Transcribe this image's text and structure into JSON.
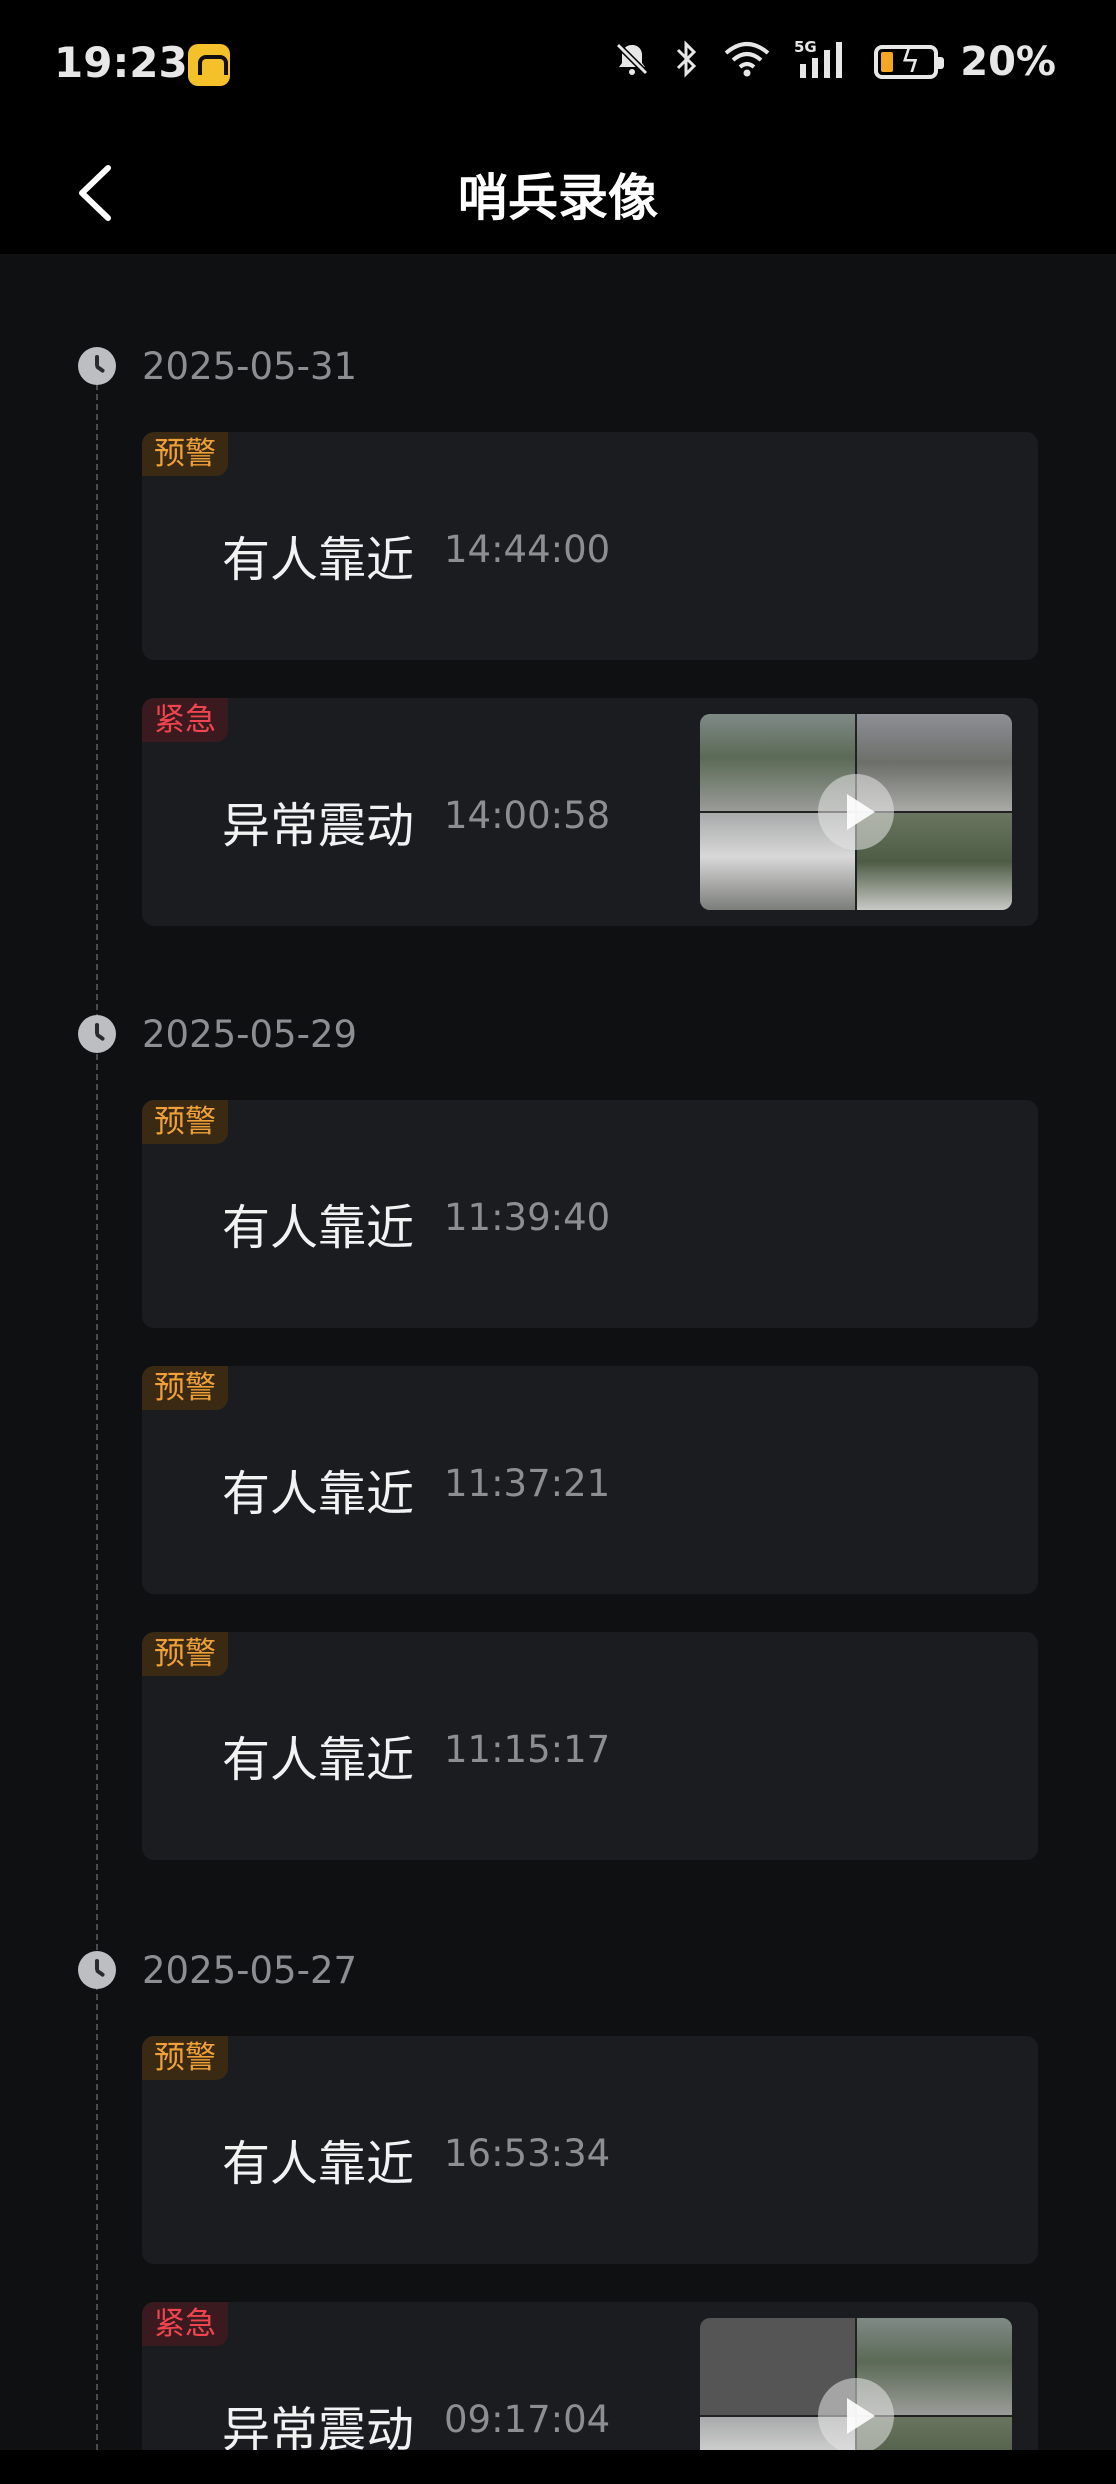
{
  "status_bar": {
    "time": "19:23",
    "battery_percent": "20%",
    "icons": [
      "app-notification-icon",
      "mute-bell-icon",
      "bluetooth-icon",
      "wifi-icon",
      "5g-signal-icon",
      "battery-charging-icon"
    ]
  },
  "header": {
    "title": "哨兵录像",
    "back_icon": "chevron-left-icon"
  },
  "timeline": [
    {
      "date": "2025-05-31",
      "events": [
        {
          "badge": "预警",
          "level": "warn",
          "name": "有人靠近",
          "time": "14:44:00",
          "has_video": false
        },
        {
          "badge": "紧急",
          "level": "urgent",
          "name": "异常震动",
          "time": "14:00:58",
          "has_video": true
        }
      ]
    },
    {
      "date": "2025-05-29",
      "events": [
        {
          "badge": "预警",
          "level": "warn",
          "name": "有人靠近",
          "time": "11:39:40",
          "has_video": false
        },
        {
          "badge": "预警",
          "level": "warn",
          "name": "有人靠近",
          "time": "11:37:21",
          "has_video": false
        },
        {
          "badge": "预警",
          "level": "warn",
          "name": "有人靠近",
          "time": "11:15:17",
          "has_video": false
        }
      ]
    },
    {
      "date": "2025-05-27",
      "events": [
        {
          "badge": "预警",
          "level": "warn",
          "name": "有人靠近",
          "time": "16:53:34",
          "has_video": false
        },
        {
          "badge": "紧急",
          "level": "urgent",
          "name": "异常震动",
          "time": "09:17:04",
          "has_video": true
        }
      ]
    }
  ],
  "colors": {
    "warn": "#f0a038",
    "urgent": "#f0454f",
    "card_bg": "#1b1c20",
    "page_bg": "#0f1012"
  }
}
